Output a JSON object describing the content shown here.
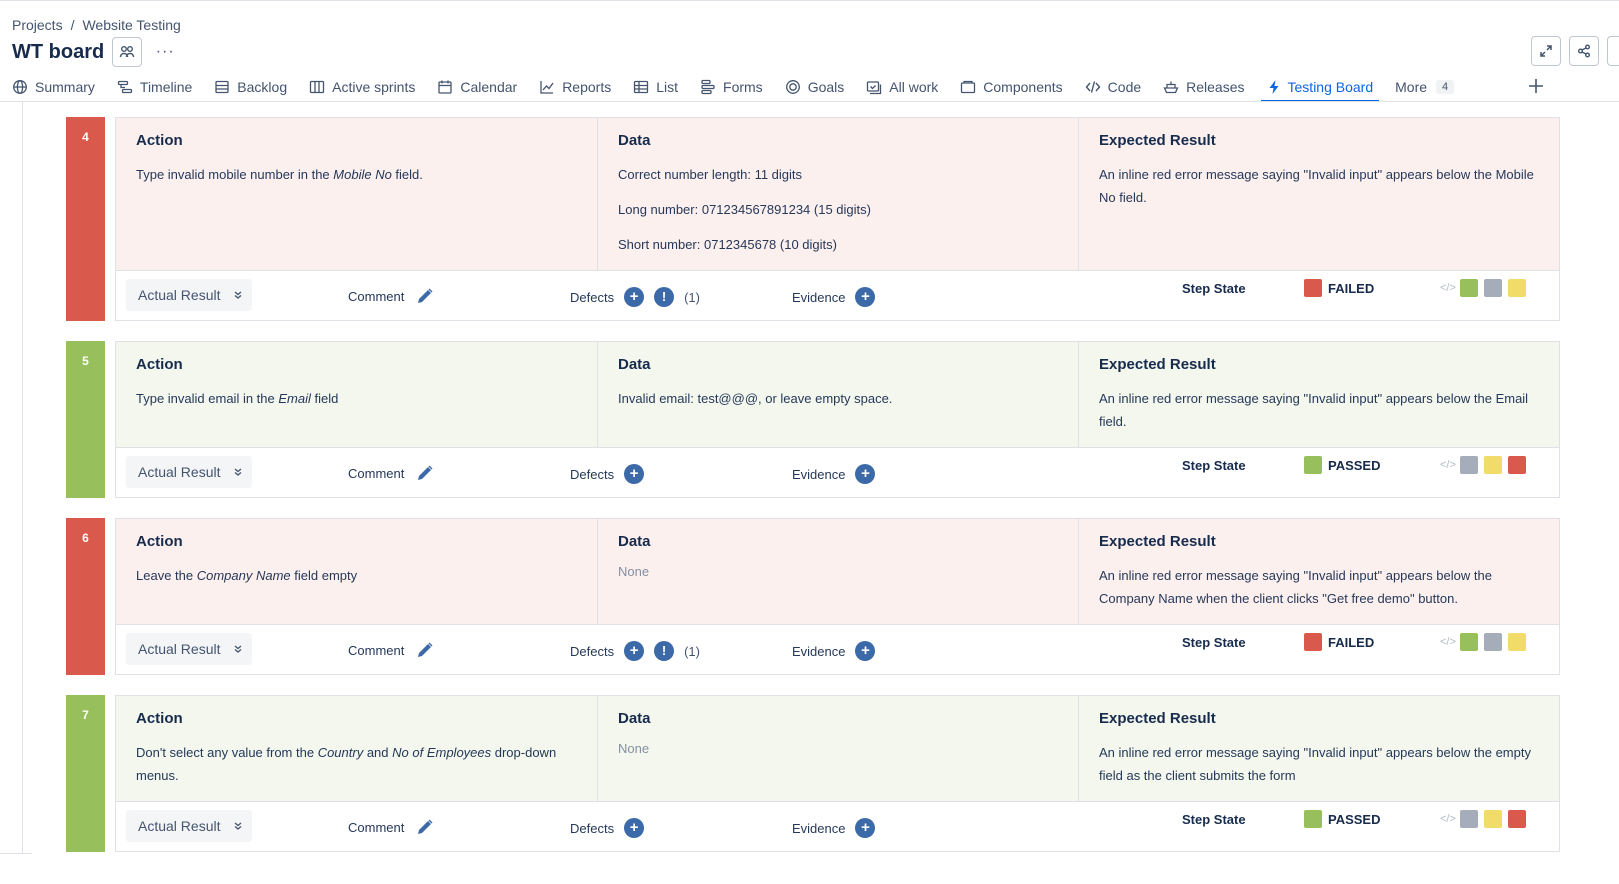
{
  "breadcrumb": {
    "projects": "Projects",
    "separator": "/",
    "current": "Website Testing"
  },
  "header": {
    "title": "WT board",
    "more": "···"
  },
  "tabs": [
    {
      "label": "Summary",
      "icon": "globe-icon"
    },
    {
      "label": "Timeline",
      "icon": "timeline-icon"
    },
    {
      "label": "Backlog",
      "icon": "backlog-icon"
    },
    {
      "label": "Active sprints",
      "icon": "board-icon"
    },
    {
      "label": "Calendar",
      "icon": "calendar-icon"
    },
    {
      "label": "Reports",
      "icon": "chart-line-icon"
    },
    {
      "label": "List",
      "icon": "table-icon"
    },
    {
      "label": "Forms",
      "icon": "forms-icon"
    },
    {
      "label": "Goals",
      "icon": "target-icon"
    },
    {
      "label": "All work",
      "icon": "all-work-icon"
    },
    {
      "label": "Components",
      "icon": "component-icon"
    },
    {
      "label": "Code",
      "icon": "code-icon"
    },
    {
      "label": "Releases",
      "icon": "ship-icon"
    },
    {
      "label": "Testing Board",
      "icon": "lightning-icon",
      "active": true
    },
    {
      "label": "More",
      "count": "4"
    }
  ],
  "labels": {
    "action": "Action",
    "data": "Data",
    "expected": "Expected Result",
    "actual_result": "Actual Result",
    "comment": "Comment",
    "defects": "Defects",
    "evidence": "Evidence",
    "step_state": "Step State",
    "none": "None",
    "plus": "+",
    "exclaim": "!"
  },
  "colors": {
    "failed": "#d9594c",
    "passed": "#97c05c",
    "blocked": "#a5adba",
    "pending": "#f1dc6a",
    "accent": "#0c66e4"
  },
  "steps": [
    {
      "number": "4",
      "status": "FAILED",
      "action_pre": "Type invalid mobile number in the ",
      "action_em": "Mobile No",
      "action_post": " field.",
      "data_lines": [
        "Correct number length: 11 digits",
        "Long number: 071234567891234 (15 digits)",
        "Short number: 0712345678 (10 digits)"
      ],
      "expected": "An inline red error message saying \"Invalid input\" appears below the Mobile No field.",
      "defect_count": "(1)"
    },
    {
      "number": "5",
      "status": "PASSED",
      "action_pre": "Type invalid email in the ",
      "action_em": "Email",
      "action_post": " field",
      "data_lines": [
        "Invalid email: test@@@, or leave empty space."
      ],
      "expected": "An inline red error message saying \"Invalid input\" appears below the Email field.",
      "defect_count": ""
    },
    {
      "number": "6",
      "status": "FAILED",
      "action_pre": "Leave the ",
      "action_em": "Company Name",
      "action_post": " field empty",
      "data_lines": [],
      "expected": "An inline red error message saying \"Invalid input\" appears below the Company Name when the client clicks \"Get free demo\" button.",
      "defect_count": "(1)"
    },
    {
      "number": "7",
      "status": "PASSED",
      "action_pre": "Don't select any value from the ",
      "action_em": "Country",
      "action_mid": " and ",
      "action_em2": "No of Employees",
      "action_post": " drop-down menus.",
      "data_lines": [],
      "expected": "An inline red error message saying \"Invalid input\" appears below the empty field as the client submits the form",
      "defect_count": ""
    }
  ]
}
